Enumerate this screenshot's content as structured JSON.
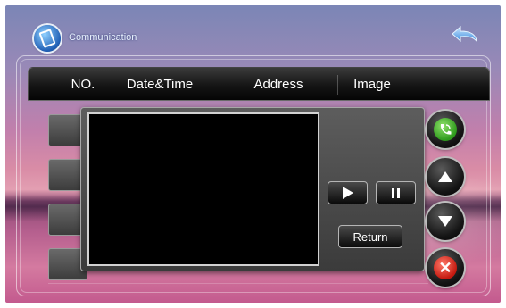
{
  "app": {
    "title": "Communication",
    "app_icon": "phone-icon",
    "back_icon": "return-arrow-icon"
  },
  "table": {
    "columns": [
      "NO.",
      "Date&Time",
      "Address",
      "Image"
    ]
  },
  "player": {
    "play_icon": "play-icon",
    "pause_icon": "pause-icon",
    "return_label": "Return"
  },
  "side_buttons": [
    {
      "name": "call-button",
      "icon": "phone-call-icon",
      "color": "#3aa82a"
    },
    {
      "name": "scroll-up-button",
      "icon": "arrow-up-icon"
    },
    {
      "name": "scroll-down-button",
      "icon": "arrow-down-icon"
    },
    {
      "name": "close-button",
      "icon": "close-icon",
      "color": "#d62a1e"
    }
  ]
}
